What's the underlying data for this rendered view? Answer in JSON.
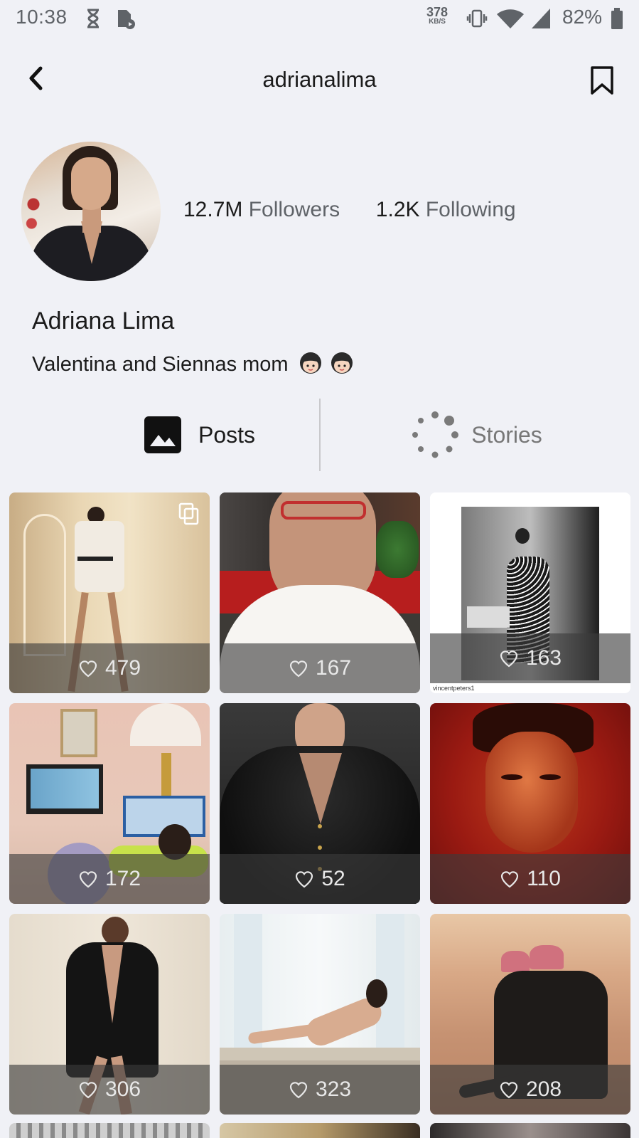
{
  "status_bar": {
    "time": "10:38",
    "net_speed": "378",
    "net_unit": "KB/S",
    "battery": "82%",
    "icons": [
      "hourglass-icon",
      "app-notification-icon",
      "vibrate-icon",
      "wifi-icon",
      "signal-icon",
      "battery-icon"
    ]
  },
  "header": {
    "title": "adrianalima",
    "back_icon": "chevron-left-icon",
    "bookmark_icon": "bookmark-icon"
  },
  "profile": {
    "followers_count": "12.7M",
    "followers_label": "Followers",
    "following_count": "1.2K",
    "following_label": "Following",
    "name": "Adriana Lima",
    "bio": "Valentina and Siennas mom"
  },
  "tabs": [
    {
      "label": "Posts",
      "icon": "image-icon",
      "active": true
    },
    {
      "label": "Stories",
      "icon": "loading-dots-icon",
      "active": false
    }
  ],
  "posts": [
    {
      "likes": "479",
      "multi": true
    },
    {
      "likes": "167"
    },
    {
      "likes": "163",
      "credit": "vincentpeters1"
    },
    {
      "likes": "172"
    },
    {
      "likes": "52"
    },
    {
      "likes": "110"
    },
    {
      "likes": "306"
    },
    {
      "likes": "323"
    },
    {
      "likes": "208"
    }
  ]
}
